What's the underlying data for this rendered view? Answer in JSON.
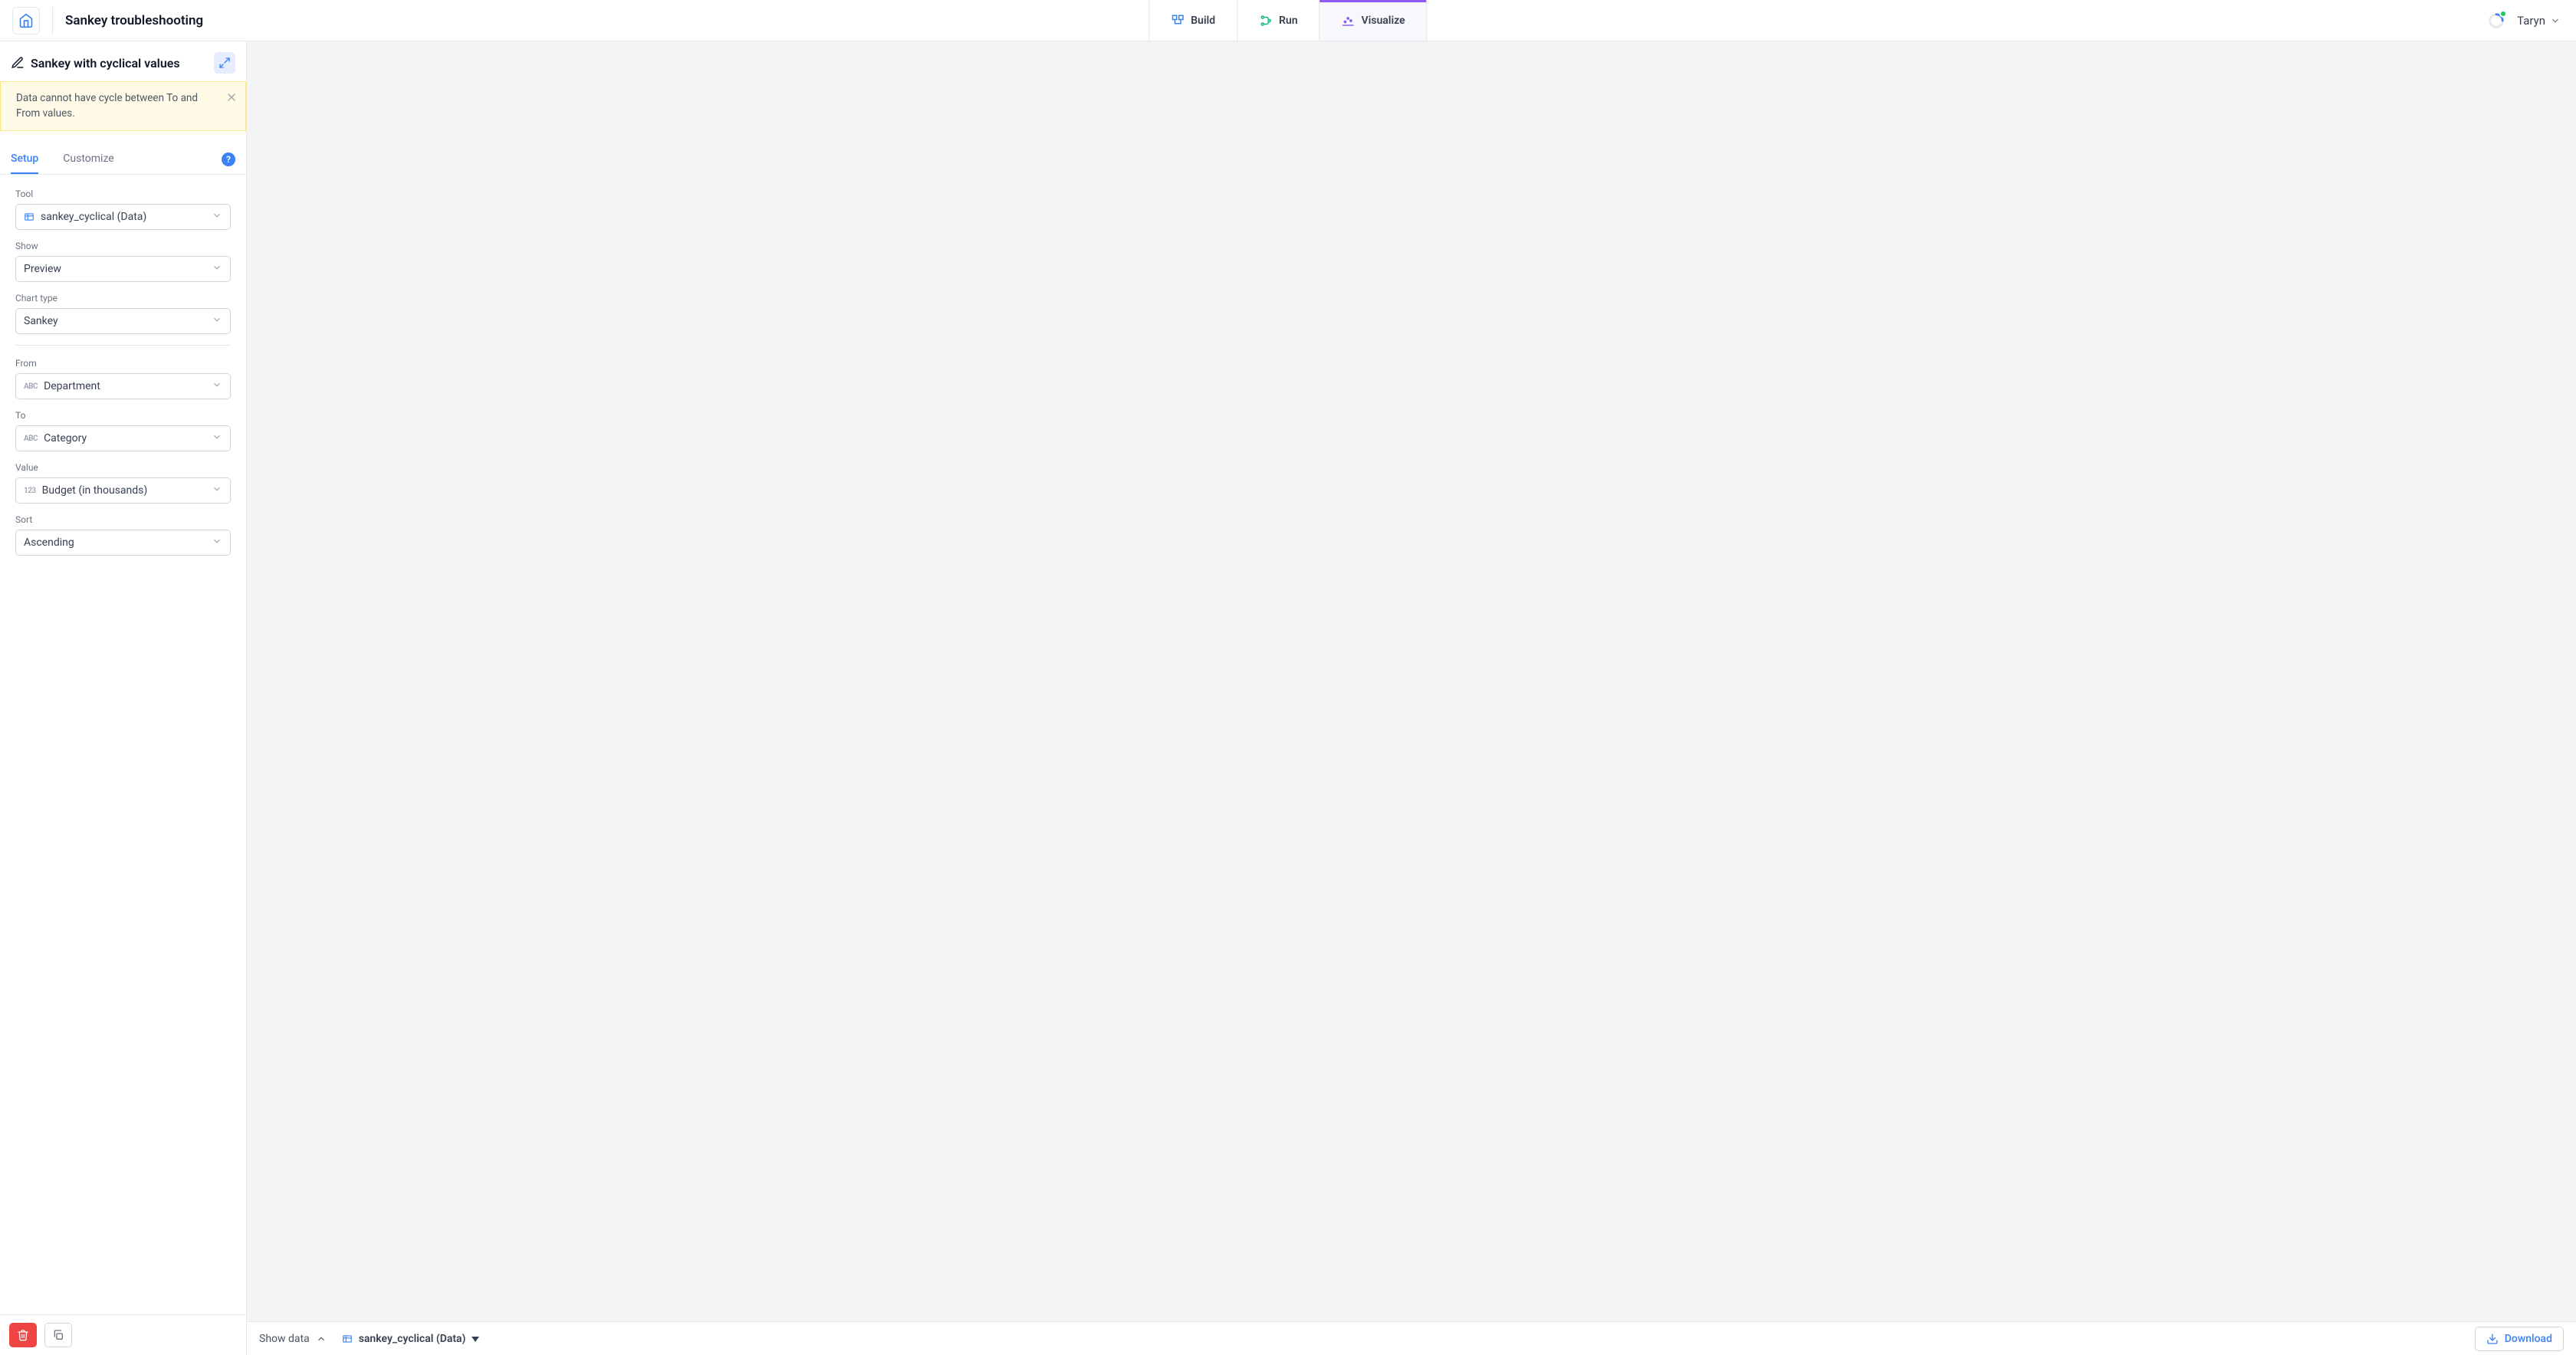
{
  "header": {
    "project_title": "Sankey troubleshooting",
    "tabs": {
      "build": "Build",
      "run": "Run",
      "visualize": "Visualize"
    },
    "user_name": "Taryn"
  },
  "panel": {
    "title": "Sankey with cyclical values",
    "warning_message": "Data cannot have cycle between To and From values.",
    "tabs": {
      "setup": "Setup",
      "customize": "Customize"
    },
    "help_label": "?"
  },
  "form": {
    "tool": {
      "label": "Tool",
      "value": "sankey_cyclical (Data)"
    },
    "show": {
      "label": "Show",
      "value": "Preview"
    },
    "chart_type": {
      "label": "Chart type",
      "value": "Sankey"
    },
    "from": {
      "label": "From",
      "value": "Department"
    },
    "to": {
      "label": "To",
      "value": "Category"
    },
    "value": {
      "label": "Value",
      "value": "Budget (in thousands)"
    },
    "sort": {
      "label": "Sort",
      "value": "Ascending"
    }
  },
  "footer": {
    "show_data": "Show data",
    "data_source": "sankey_cyclical (Data)",
    "download": "Download"
  }
}
